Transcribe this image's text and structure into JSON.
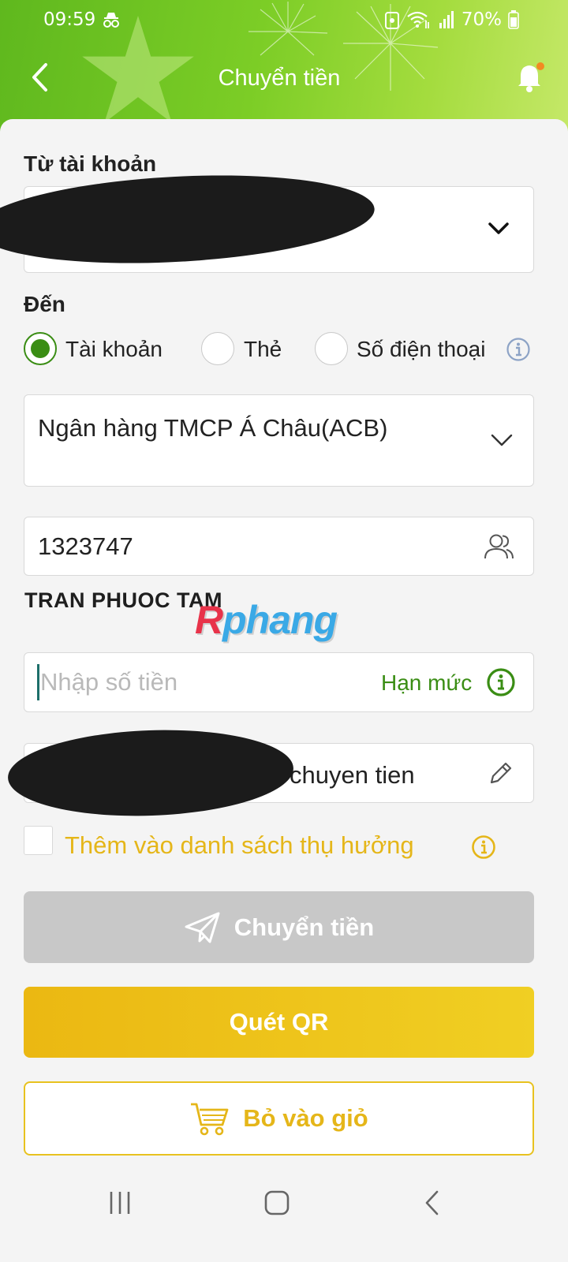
{
  "status_bar": {
    "time": "09:59",
    "battery": "70%"
  },
  "header": {
    "title": "Chuyển tiền"
  },
  "from": {
    "label": "Từ tài khoản"
  },
  "to": {
    "label": "Đến",
    "options": [
      "Tài khoản",
      "Thẻ",
      "Số điện thoại"
    ],
    "selected": "Tài khoản"
  },
  "bank": {
    "value": "Ngân hàng TMCP Á Châu(ACB)"
  },
  "account": {
    "number": "1323747",
    "holder": "TRAN PHUOC TAM"
  },
  "watermark": {
    "r": "R",
    "rest": "phang"
  },
  "amount": {
    "placeholder": "Nhập số tiền",
    "limit_label": "Hạn mức"
  },
  "note": {
    "value_visible": "chuyen tien"
  },
  "favorite": {
    "label": "Thêm vào danh sách thụ hưởng",
    "checked": false
  },
  "buttons": {
    "transfer": "Chuyển tiền",
    "scan_qr": "Quét QR",
    "add_to_cart": "Bỏ vào giỏ"
  },
  "colors": {
    "header_green": "#7ccd26",
    "primary_green": "#3a8d14",
    "gold": "#e5b619",
    "disabled_gray": "#c8c8c8"
  },
  "icons": {
    "back": "back-arrow-icon",
    "bell": "bell-icon",
    "chevron": "chevron-down-icon",
    "info": "info-icon",
    "contacts": "contacts-icon",
    "edit": "pencil-icon",
    "send": "paper-plane-icon",
    "cart": "cart-icon"
  }
}
